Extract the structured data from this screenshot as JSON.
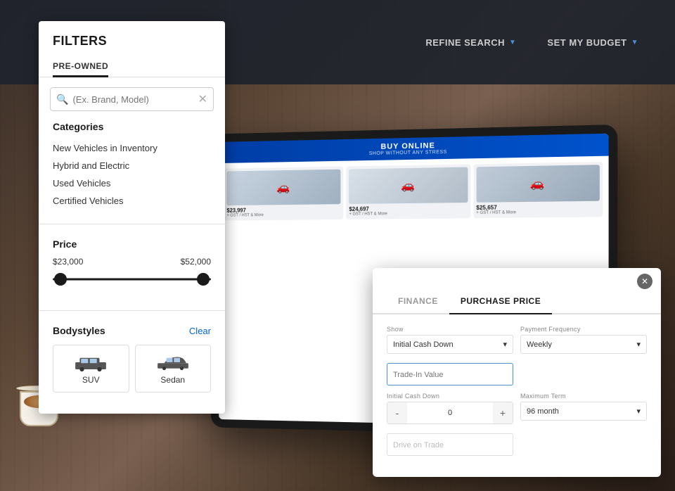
{
  "topbar": {
    "refine_search_label": "REFINE SEARCH",
    "set_budget_label": "SET MY BUDGET"
  },
  "filters": {
    "title": "FILTERS",
    "tab_preowned": "PRE-OWNED",
    "search_placeholder": "(Ex. Brand, Model)",
    "categories_title": "Categories",
    "categories": [
      "New Vehicles in Inventory",
      "Hybrid and Electric",
      "Used Vehicles",
      "Certified Vehicles"
    ],
    "price_title": "Price",
    "price_min": "$23,000",
    "price_max": "$52,000",
    "bodystyles_title": "Bodystyles",
    "clear_label": "Clear",
    "bodystyles": [
      {
        "label": "SUV",
        "type": "suv"
      },
      {
        "label": "Sedan",
        "type": "sedan"
      }
    ]
  },
  "finance_modal": {
    "tab_finance": "FINANCE",
    "tab_purchase_price": "PURCHASE PRICE",
    "show_label": "Show",
    "initial_cash_down_label": "Initial Cash Down",
    "initial_cash_down_value": "Initial Cash Down",
    "initial_cash_down_amount": "0",
    "payment_frequency_label": "Payment Frequency",
    "payment_frequency_value": "Weekly",
    "maximum_term_label": "Maximum Term",
    "maximum_term_value": "96 month",
    "trade_in_label": "Trade-In Value",
    "trade_in_placeholder": "Trade-In Value",
    "drive_on_trade_label": "Drive on Trade",
    "drive_on_trade_placeholder": "Drive on Trade",
    "minus_label": "-",
    "plus_label": "+"
  },
  "tablet": {
    "header_text": "BUY ONLINE",
    "header_sub": "SHOP WITHOUT ANY STRESS",
    "cars": [
      {
        "price": "$23,997",
        "sub": "+ GST / HST & More"
      },
      {
        "price": "$24,697",
        "sub": "+ GST / HST & More"
      },
      {
        "price": "$25,657",
        "sub": "+ GST / HST & More"
      }
    ]
  }
}
